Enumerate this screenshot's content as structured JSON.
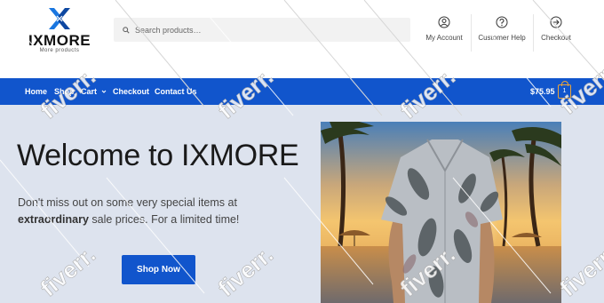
{
  "header": {
    "logo_text": "IXMORE",
    "logo_sub": "More products",
    "search_placeholder": "Search products…",
    "nav": [
      {
        "label": "My Account",
        "icon": "user-circle-icon"
      },
      {
        "label": "Customer Help",
        "icon": "help-circle-icon"
      },
      {
        "label": "Checkout",
        "icon": "arrow-circle-icon"
      }
    ]
  },
  "navbar": {
    "items": [
      "Home",
      "Shop",
      "Cart",
      "Checkout",
      "Contact Us"
    ],
    "cart_total": "$75.95",
    "cart_count": "1"
  },
  "hero": {
    "title": "Welcome to IXMORE",
    "text_before": "Don't miss out on some very special items at ",
    "text_bold": "extraordinary",
    "text_after": " sale prices. For a limited time!",
    "button": "Shop Now"
  },
  "watermark": "fiverr.",
  "colors": {
    "brand_blue": "#1155cc",
    "hero_bg": "#dde3ee",
    "cart_accent": "#e8a33a"
  }
}
